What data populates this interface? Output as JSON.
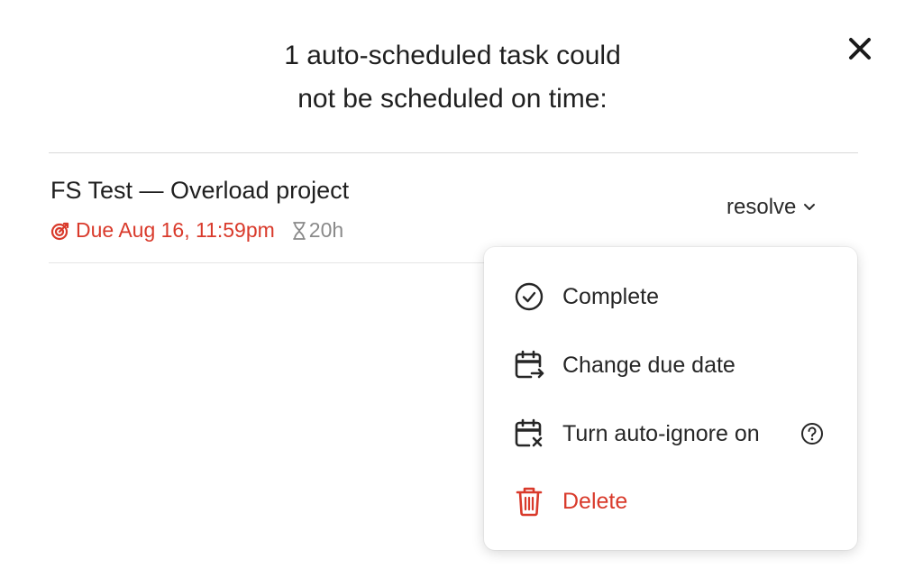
{
  "dialog": {
    "title_line1": "1 auto-scheduled task could",
    "title_line2": "not be scheduled on time:",
    "close_icon": "close-icon"
  },
  "task": {
    "title": "FS Test — Overload project",
    "due_icon": "target-icon",
    "due_text": "Due Aug 16, 11:59pm",
    "duration_icon": "hourglass-icon",
    "duration_text": "20h",
    "resolve_label": "resolve"
  },
  "menu": {
    "items": [
      {
        "label": "Complete",
        "icon": "check-circle-icon"
      },
      {
        "label": "Change due date",
        "icon": "calendar-arrow-icon"
      },
      {
        "label": "Turn auto-ignore on",
        "icon": "calendar-x-icon"
      },
      {
        "label": "Delete",
        "icon": "trash-icon"
      }
    ],
    "help_icon": "help-circle-icon"
  },
  "colors": {
    "danger": "#d93a2b",
    "muted": "#8a8a8a",
    "text": "#1f1f1f"
  }
}
